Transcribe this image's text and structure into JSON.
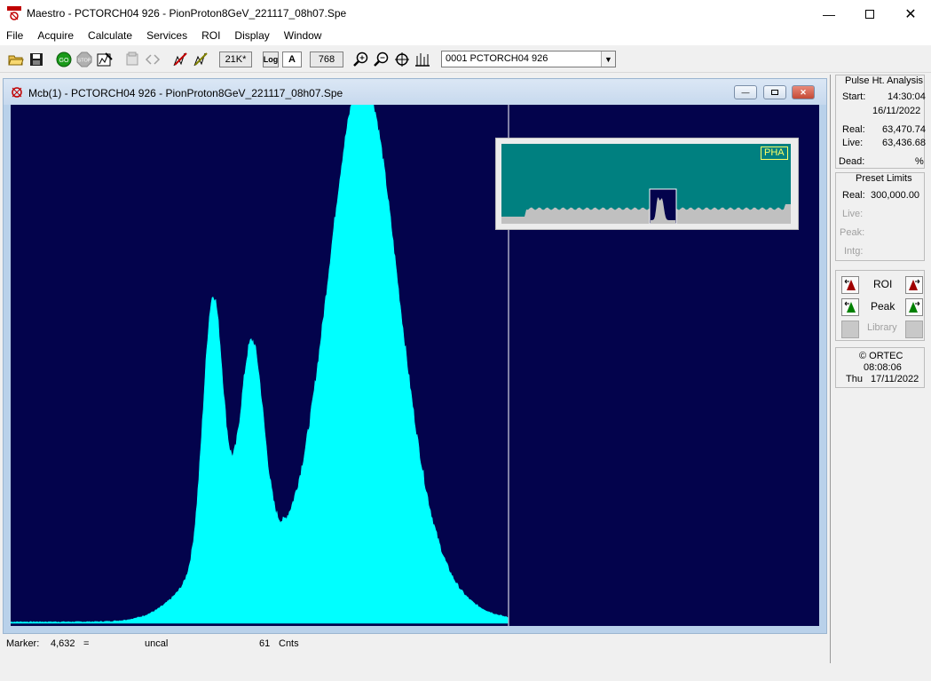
{
  "window": {
    "title": "Maestro - PCTORCH04 926 - PionProton8GeV_221117_08h07.Spe"
  },
  "menu": [
    "File",
    "Acquire",
    "Calculate",
    "Services",
    "ROI",
    "Display",
    "Window"
  ],
  "toolbar": {
    "fullscale_label": "21K*",
    "log_label": "Log",
    "auto_label": "A",
    "horizontal_scale": "768",
    "detector_select": "0001  PCTORCH04 926",
    "icons": [
      "open-folder-icon",
      "save-icon",
      "go-icon",
      "stop-icon",
      "clear-icon",
      "copy-buffer-icon",
      "detector-buffer-icon",
      "roi-mark-icon",
      "roi-unmark-icon",
      "zoom-in-icon",
      "zoom-out-icon",
      "center-icon",
      "baseline-zoom-icon"
    ]
  },
  "mdi": {
    "title": "Mcb(1) - PCTORCH04 926 - PionProton8GeV_221117_08h07.Spe",
    "overview_badge": "PHA"
  },
  "colors": {
    "spectrum_bg": "#03034c",
    "spectrum_fill": "#00ffff",
    "overview_bg": "#008080",
    "overview_fill": "#c0c0c0"
  },
  "status": {
    "label": "Marker:",
    "channel": "4,632",
    "eq": "=",
    "energy": "uncal",
    "counts": "61",
    "counts_unit": "Cnts"
  },
  "panel": {
    "pha": {
      "title": "Pulse Ht. Analysis",
      "start_label": "Start:",
      "start_time": "14:30:04",
      "start_date": "16/11/2022",
      "real_label": "Real:",
      "real_value": "63,470.74",
      "live_label": "Live:",
      "live_value": "63,436.68",
      "dead_label": "Dead:",
      "dead_unit": "%"
    },
    "preset": {
      "title": "Preset Limits",
      "real_label": "Real:",
      "real_value": "300,000.00",
      "live_label": "Live:",
      "peak_label": "Peak:",
      "intg_label": "Intg:"
    },
    "nav": {
      "roi_label": "ROI",
      "peak_label": "Peak",
      "library_label": "Library"
    },
    "clock": {
      "copyright": "© ORTEC",
      "time": "08:08:06",
      "day": "Thu",
      "date": "17/11/2022"
    }
  }
}
